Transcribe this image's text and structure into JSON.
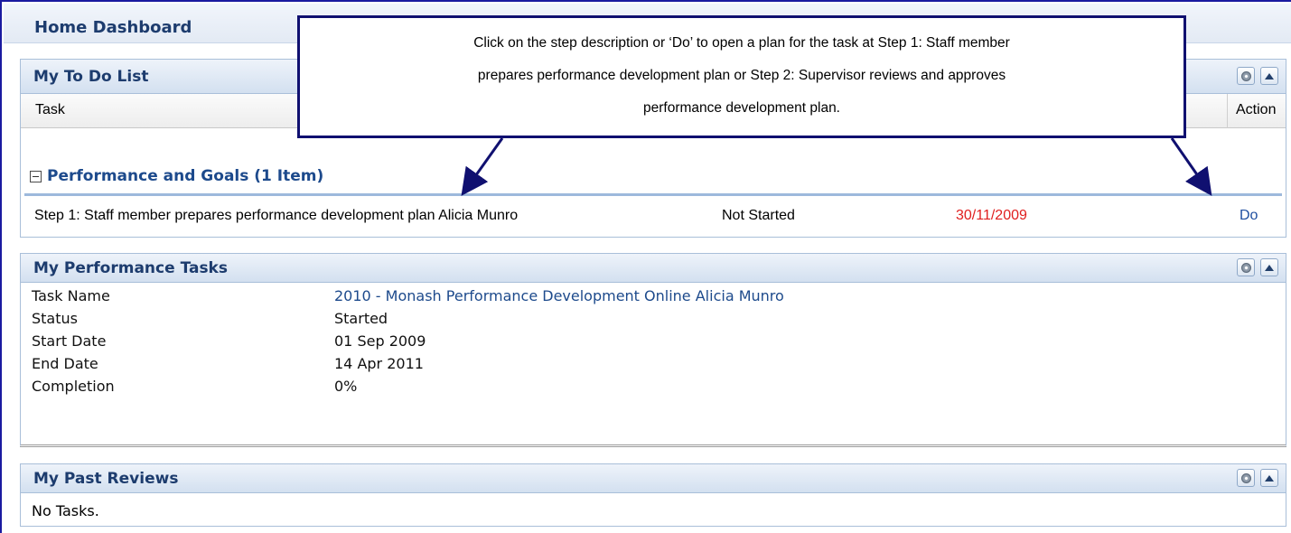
{
  "header": {
    "title": "Home Dashboard"
  },
  "callout": {
    "line1": "Click on the step description or ‘Do’ to open a plan for the task at Step 1: Staff member",
    "line2": "prepares performance development plan or Step 2: Supervisor reviews and approves",
    "line3": "performance development plan."
  },
  "todo": {
    "title": "My To Do List",
    "columns": {
      "task": "Task",
      "action": "Action"
    },
    "group": "Performance and Goals (1 Item)",
    "row": {
      "task": "Step 1: Staff member prepares performance development plan Alicia Munro",
      "status": "Not Started",
      "date": "30/11/2009",
      "action": "Do"
    }
  },
  "perf": {
    "title": "My Performance Tasks",
    "rows": [
      {
        "key": "Task Name",
        "value": "2010 - Monash Performance Development Online Alicia Munro"
      },
      {
        "key": "Status",
        "value": "Started"
      },
      {
        "key": "Start Date",
        "value": "01 Sep 2009"
      },
      {
        "key": "End Date",
        "value": "14 Apr 2011"
      },
      {
        "key": "Completion",
        "value": "0%"
      }
    ]
  },
  "past": {
    "title": "My Past Reviews",
    "empty": "No Tasks."
  },
  "icons": {
    "settings": "gear-icon",
    "collapse": "collapse-up-icon",
    "group_toggle": "minus-box-icon"
  },
  "colors": {
    "accent": "#1d3c6e",
    "link": "#1d4a8c",
    "overdue": "#e02020",
    "callout_border": "#101070"
  }
}
